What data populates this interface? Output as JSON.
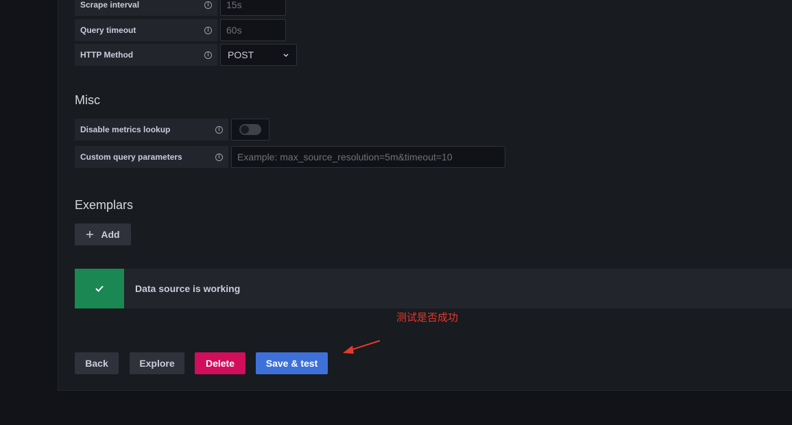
{
  "settings": {
    "scrape_interval": {
      "label": "Scrape interval",
      "placeholder": "15s"
    },
    "query_timeout": {
      "label": "Query timeout",
      "placeholder": "60s"
    },
    "http_method": {
      "label": "HTTP Method",
      "value": "POST"
    }
  },
  "misc": {
    "title": "Misc",
    "disable_metrics_lookup": {
      "label": "Disable metrics lookup",
      "enabled": false
    },
    "custom_query_parameters": {
      "label": "Custom query parameters",
      "placeholder": "Example: max_source_resolution=5m&timeout=10"
    }
  },
  "exemplars": {
    "title": "Exemplars",
    "add_label": "Add"
  },
  "alert": {
    "message": "Data source is working",
    "status_color": "#1b8753"
  },
  "annotation": {
    "text": "测试是否成功",
    "color": "#e8382e"
  },
  "actions": {
    "back_label": "Back",
    "explore_label": "Explore",
    "delete_label": "Delete",
    "save_test_label": "Save & test"
  },
  "icons": {
    "info": "info-icon",
    "chevron": "chevron-down-icon",
    "plus": "plus-icon",
    "check": "check-icon",
    "arrow": "arrow-annotation-icon"
  },
  "colors": {
    "primary": "#3d71d9",
    "danger": "#d10e5c",
    "success": "#1b8753"
  }
}
